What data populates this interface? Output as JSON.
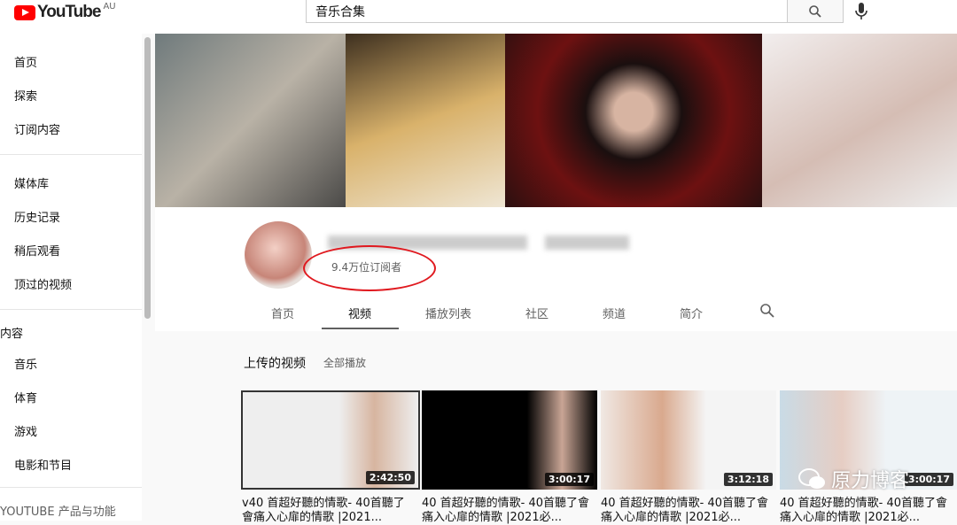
{
  "header": {
    "logo_text": "YouTube",
    "region": "AU",
    "search_value": "音乐合集"
  },
  "sidebar": {
    "items": [
      "首页",
      "探索",
      "订阅内容",
      "媒体库",
      "历史记录",
      "稍后观看",
      "顶过的视频"
    ],
    "section_heading": "内容",
    "section_items": [
      "音乐",
      "体育",
      "游戏",
      "电影和节目"
    ],
    "footer_heading": "YOUTUBE 产品与功能"
  },
  "channel": {
    "subscribers": "9.4万位订阅者",
    "tabs": [
      "首页",
      "视频",
      "播放列表",
      "社区",
      "频道",
      "简介"
    ],
    "active_tab": "视频",
    "annotation_color": "#e0191f"
  },
  "section": {
    "title": "上传的视频",
    "play_all": "全部播放"
  },
  "videos": [
    {
      "duration": "2:42:50",
      "title": "v40 首超好聽的情歌- 40首聽了會痛入心扉的情歌 |2021..."
    },
    {
      "duration": "3:00:17",
      "title": "40 首超好聽的情歌- 40首聽了會痛入心扉的情歌 |2021必..."
    },
    {
      "duration": "3:12:18",
      "title": "40 首超好聽的情歌- 40首聽了會痛入心扉的情歌 |2021必..."
    },
    {
      "duration": "3:00:17",
      "title": "40 首超好聽的情歌- 40首聽了會痛入心扉的情歌 |2021必..."
    }
  ],
  "watermark": "原力博客"
}
